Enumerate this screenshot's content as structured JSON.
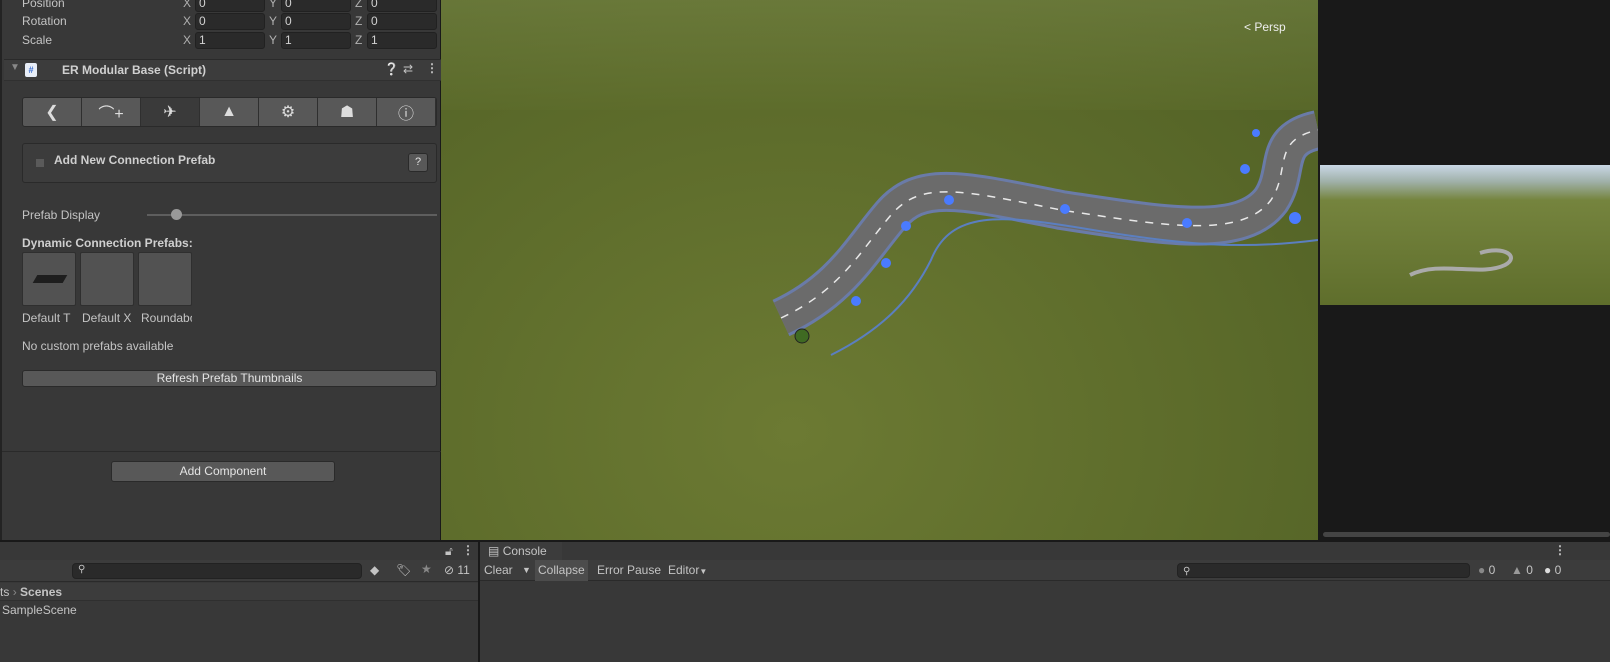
{
  "transform": {
    "rows": [
      {
        "label": "Position",
        "x": "0",
        "y": "0",
        "z": "0"
      },
      {
        "label": "Rotation",
        "x": "0",
        "y": "0",
        "z": "0"
      },
      {
        "label": "Scale",
        "x": "1",
        "y": "1",
        "z": "1"
      }
    ],
    "axis_labels": [
      "X",
      "Y",
      "Z"
    ]
  },
  "component": {
    "title": "ER Modular Base (Script)",
    "tabs": [
      "back",
      "add-road",
      "connections",
      "terrain",
      "settings",
      "prefab",
      "info"
    ],
    "active_tab": 2,
    "add_connection_label": "Add New Connection Prefab",
    "help_label": "?",
    "prefab_display_label": "Prefab Display",
    "prefab_display_value": 0.2,
    "dynamic_label": "Dynamic Connection Prefabs:",
    "prefabs": [
      "Default T",
      "Default X",
      "Roundabout"
    ],
    "no_custom": "No custom prefabs available",
    "refresh_label": "Refresh Prefab Thumbnails"
  },
  "add_component_label": "Add Component",
  "scene": {
    "persp_label": "Persp"
  },
  "project": {
    "breadcrumb": [
      "ts",
      "Scenes"
    ],
    "items": [
      "SampleScene"
    ],
    "hidden_count": "11",
    "search_placeholder": ""
  },
  "console": {
    "tab_label": "Console",
    "clear": "Clear",
    "collapse": "Collapse",
    "error_pause": "Error Pause",
    "editor": "Editor",
    "info_count": "0",
    "warn_count": "0",
    "error_count": "0"
  }
}
